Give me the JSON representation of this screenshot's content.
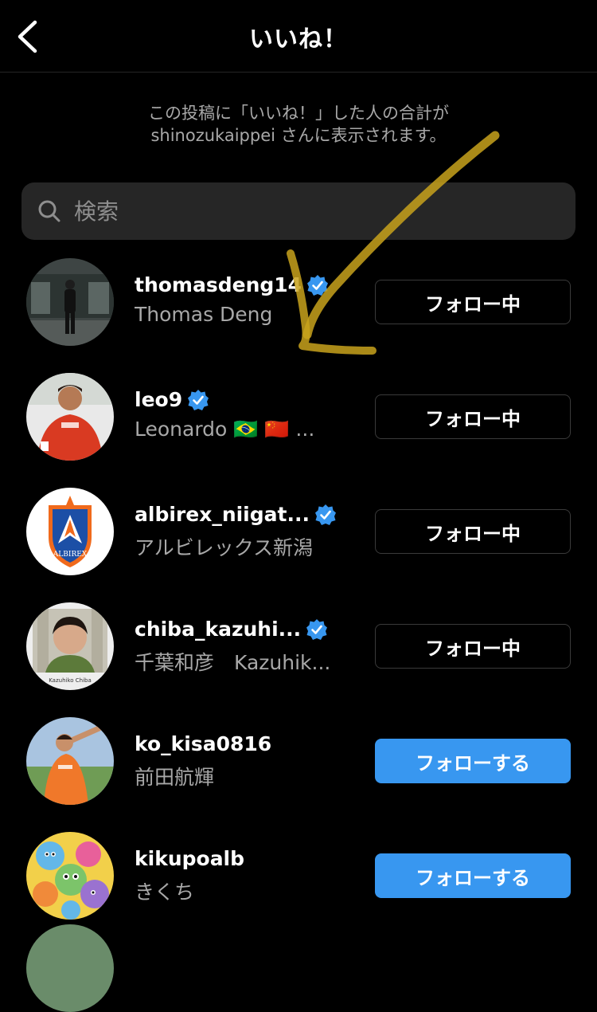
{
  "header": {
    "title": "いいね！",
    "back_icon": "chevron-left-icon"
  },
  "notice": {
    "line1": "この投稿に「いいね！」した人の合計が",
    "line2": "shinozukaippei さんに表示されます。"
  },
  "search": {
    "placeholder": "検索",
    "value": ""
  },
  "colors": {
    "background": "#000000",
    "follow_button": "#3897f0",
    "verified": "#3897f0",
    "secondary_text": "#a8a8a8",
    "annotation": "#c8a21c"
  },
  "users": [
    {
      "username": "thomasdeng14",
      "full_name": "Thomas Deng",
      "verified": true,
      "button": "フォロー中"
    },
    {
      "username": "leo9",
      "full_name": "Leonardo 🇧🇷 🇨🇳 ...",
      "verified": true,
      "button": "フォロー中"
    },
    {
      "username": "albirex_niigat...",
      "full_name": "アルビレックス新潟",
      "verified": true,
      "button": "フォロー中"
    },
    {
      "username": "chiba_kazuhi...",
      "full_name": "千葉和彦　Kazuhik...",
      "verified": true,
      "button": "フォロー中"
    },
    {
      "username": "ko_kisa0816",
      "full_name": "前田航輝",
      "verified": false,
      "button": "フォローする"
    },
    {
      "username": "kikupoalb",
      "full_name": "きくち",
      "verified": false,
      "button": "フォローする"
    }
  ],
  "avatar_labels": {
    "albirex": "ALBIREX",
    "chiba": "Kazuhiko Chiba"
  }
}
